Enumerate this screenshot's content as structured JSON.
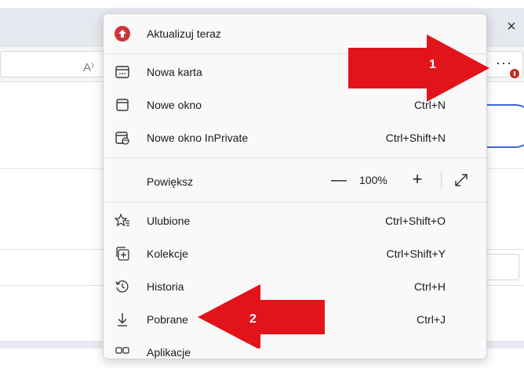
{
  "browser": {
    "close_glyph": "×",
    "read_aloud_glyph": "A⁾",
    "more_glyph": "···"
  },
  "menu": {
    "items": [
      {
        "label": "Aktualizuj teraz",
        "shortcut": "",
        "icon": "update-icon"
      },
      {
        "label": "Nowa karta",
        "shortcut": "",
        "icon": "new-tab-icon"
      },
      {
        "label": "Nowe okno",
        "shortcut": "Ctrl+N",
        "icon": "new-window-icon"
      },
      {
        "label": "Nowe okno InPrivate",
        "shortcut": "Ctrl+Shift+N",
        "icon": "inprivate-icon"
      },
      {
        "label": "Ulubione",
        "shortcut": "Ctrl+Shift+O",
        "icon": "favorites-icon"
      },
      {
        "label": "Kolekcje",
        "shortcut": "Ctrl+Shift+Y",
        "icon": "collections-icon"
      },
      {
        "label": "Historia",
        "shortcut": "Ctrl+H",
        "icon": "history-icon"
      },
      {
        "label": "Pobrane",
        "shortcut": "Ctrl+J",
        "icon": "downloads-icon"
      },
      {
        "label": "Aplikacje",
        "shortcut": "",
        "icon": "apps-icon"
      }
    ],
    "zoom": {
      "label": "Powiększ",
      "minus": "—",
      "value": "100%",
      "plus": "+"
    }
  },
  "annotations": [
    {
      "number": "1",
      "color": "#e3131b"
    },
    {
      "number": "2",
      "color": "#e3131b"
    }
  ]
}
